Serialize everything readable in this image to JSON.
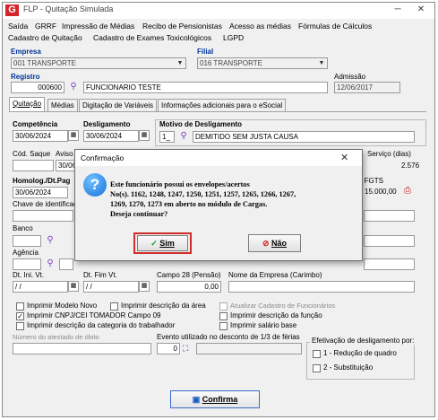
{
  "window": {
    "title": "FLP - Quitação Simulada",
    "logo": "G",
    "minimize_icon": "─",
    "close_icon": "✕"
  },
  "menu": {
    "row1": [
      "Saída",
      "GRRF",
      "Impressão de Médias",
      "Recibo de Pensionistas",
      "Acesso as médias",
      "Fórmulas de Cálculos"
    ],
    "row2": [
      "Cadastro de Quitação",
      "Cadastro de Exames Toxicológicos",
      "LGPD"
    ]
  },
  "empresa": {
    "label": "Empresa",
    "value": "001 TRANSPORTE"
  },
  "filial": {
    "label": "Filial",
    "value": "016 TRANSPORTE"
  },
  "registro": {
    "label": "Registro",
    "code": "000600",
    "name": "FUNCIONARIO TESTE"
  },
  "admissao": {
    "label": "Admissão",
    "value": "12/06/2017"
  },
  "tabs": [
    "Quitação",
    "Médias",
    "Digitação de Variáveis",
    "Informações adicionais para o eSocial"
  ],
  "competencia": {
    "label": "Competência",
    "value": "30/06/2024"
  },
  "desligamento": {
    "label": "Desligamento",
    "value": "30/06/2024"
  },
  "motivo": {
    "label": "Motivo de Desligamento",
    "code": "1_",
    "desc": "DEMITIDO SEM JUSTA CAUSA"
  },
  "cod_saque": {
    "label": "Cód. Saque"
  },
  "aviso": {
    "label": "Aviso",
    "value_partial": "30/06"
  },
  "servico": {
    "label": "Serviço (dias)",
    "value": "2.576"
  },
  "homolog": {
    "label": "Homolog./Dt.Pag",
    "value": "30/06/2024"
  },
  "fgts": {
    "label": "o FGTS",
    "value": "15.000,00"
  },
  "chave": {
    "label": "Chave de identificaç"
  },
  "banco": {
    "label": "Banco"
  },
  "agencia": {
    "label": "Agência"
  },
  "dt_ini_vt": {
    "label": "Dt. Ini. Vt.",
    "value": "/ /"
  },
  "dt_fim_vt": {
    "label": "Dt. Fim Vt.",
    "value": "/ /"
  },
  "campo28": {
    "label": "Campo 28 (Pensão)",
    "value": "0,00"
  },
  "nome_empresa": {
    "label": "Nome da Empresa (Carimbo)"
  },
  "checks": {
    "modelo_novo": "Imprimir Modelo Novo",
    "descricao_area": "Imprimir descrição da área",
    "atualizar": "Atualizar Cadastro de Funcionários",
    "cnpj": "Imprimir CNPJ/CEI TOMADOR Campo 09",
    "descricao_funcao": "Imprimir descrição da função",
    "categoria": "Imprimir descrição da categoria do trabalhador",
    "salario_base": "Imprimir salário base"
  },
  "atestado": {
    "label": "Número do atestado de óbito"
  },
  "evento": {
    "label": "Evento utilizado no desconto de 1/3 de férias",
    "code": "0"
  },
  "efetivacao": {
    "label": "Efetivação de desligamento por:",
    "opt1": "1 - Redução de quadro",
    "opt2": "2 - Substituição"
  },
  "confirm_button": {
    "label": "Confirma"
  },
  "dialog": {
    "title": "Confirmação",
    "message": "Este funcionário possui os envelopes/acertos\nNo(s). 1162, 1248, 1247, 1250, 1251, 1257, 1265, 1266, 1267,\n1269, 1270, 1273 em aberto no módulo de Cargas.\n Deseja continuar?",
    "yes": "Sim",
    "no": "Não"
  }
}
